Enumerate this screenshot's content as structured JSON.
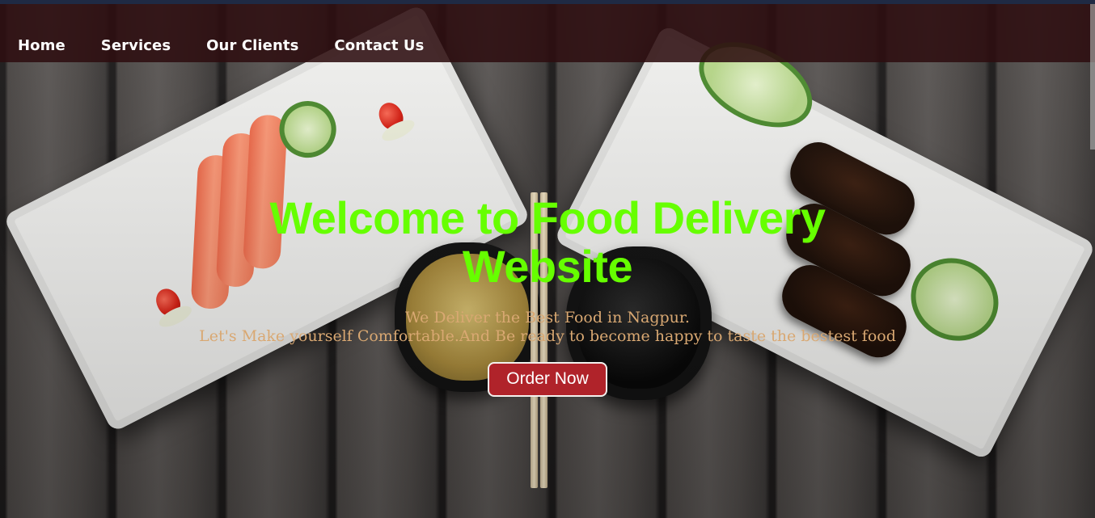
{
  "nav": {
    "items": [
      {
        "label": "Home"
      },
      {
        "label": "Services"
      },
      {
        "label": "Our Clients"
      },
      {
        "label": "Contact Us"
      }
    ]
  },
  "hero": {
    "title": "Welcome to Food Delivery Website",
    "subtitle_line1": "We Deliver the Best Food in Nagpur.",
    "subtitle_line2": "Let's Make yourself Comfortable.And Be ready to become happy to taste the bestest food",
    "cta_label": "Order Now"
  },
  "colors": {
    "navbar_bg": "#2d0e10",
    "title": "#66ff00",
    "subtitle": "#d9a872",
    "button_bg": "#b0232a"
  }
}
